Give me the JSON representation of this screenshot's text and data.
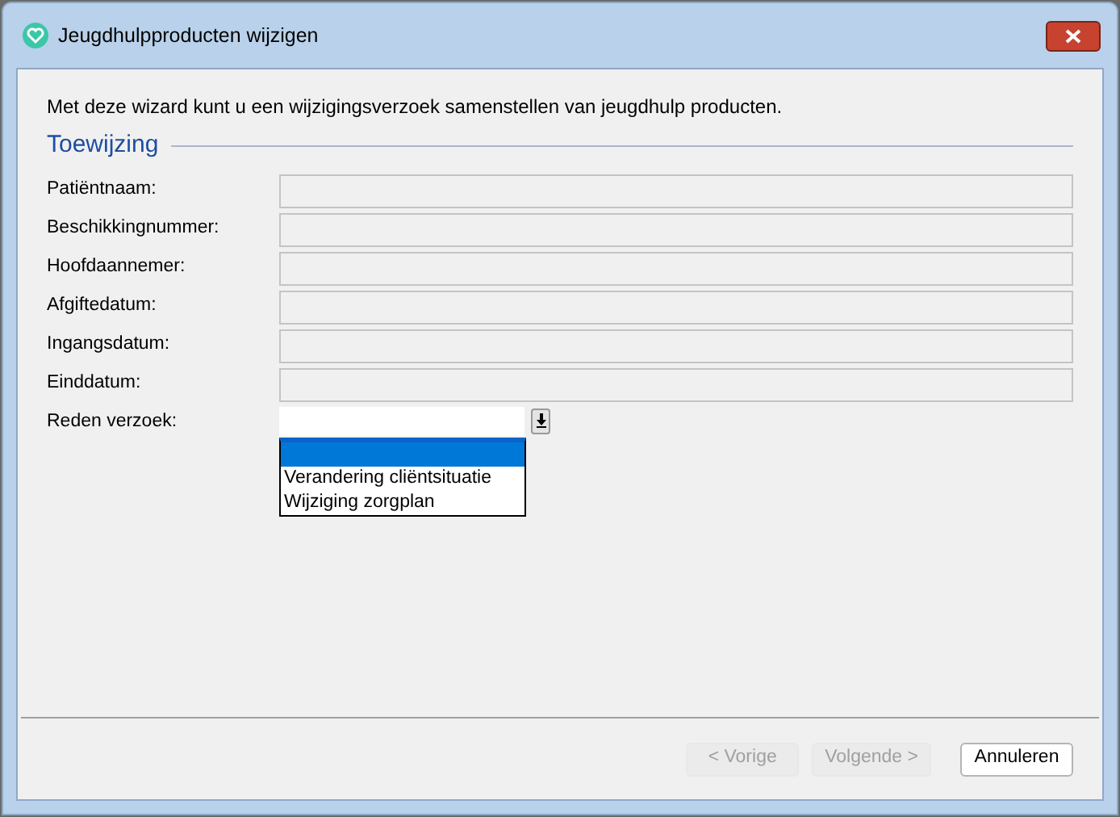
{
  "window": {
    "title": "Jeugdhulpproducten wijzigen"
  },
  "intro": "Met deze wizard kunt u een wijzigingsverzoek samenstellen van jeugdhulp producten.",
  "section": "Toewijzing",
  "fields": [
    {
      "label": "Patiëntnaam:"
    },
    {
      "label": "Beschikkingnummer:"
    },
    {
      "label": "Hoofdaannemer:"
    },
    {
      "label": "Afgiftedatum:"
    },
    {
      "label": "Ingangsdatum:"
    },
    {
      "label": "Einddatum:"
    }
  ],
  "reason": {
    "label": "Reden verzoek:",
    "expanded": true,
    "options": [
      {
        "selected": true
      },
      {
        "label": "Verandering cliëntsituatie",
        "selected": false
      },
      {
        "label": "Wijziging zorgplan",
        "selected": false
      }
    ]
  },
  "buttons": [
    {
      "label": "< Vorige",
      "disabled": true
    },
    {
      "label": "Volgende >",
      "disabled": true
    },
    {
      "label": "Annuleren",
      "disabled": false
    }
  ]
}
